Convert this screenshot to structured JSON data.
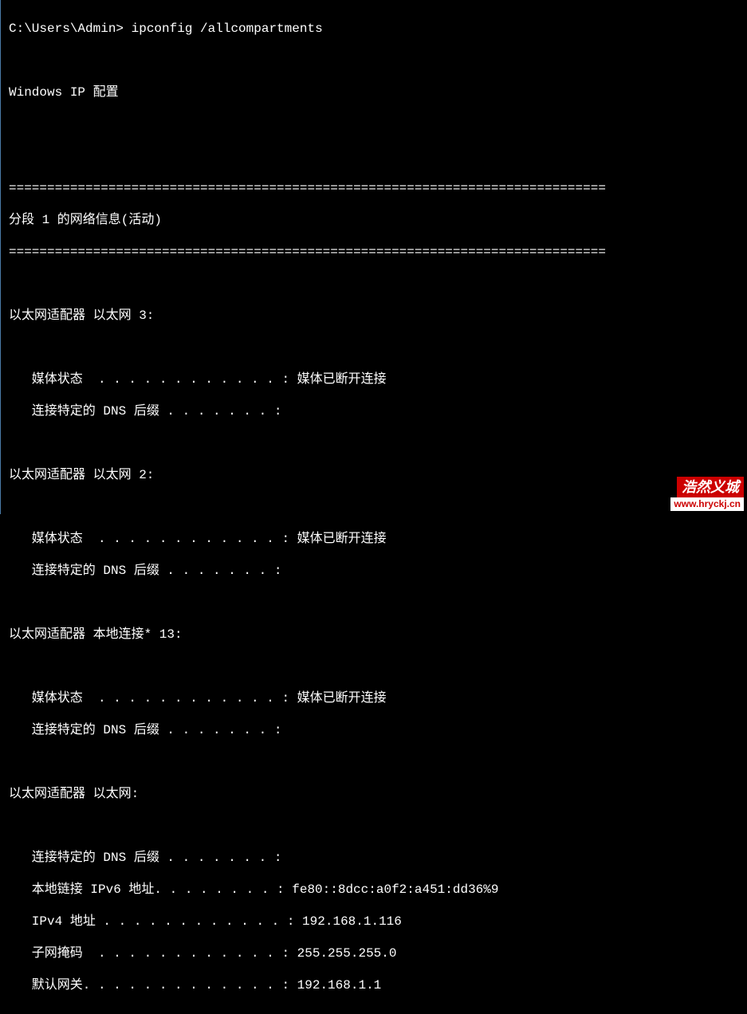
{
  "prompt": "C:\\Users\\Admin> ",
  "command": "ipconfig /allcompartments",
  "blank": "",
  "ip_config_header": "Windows IP 配置",
  "divider": "==============================================================================",
  "compartment_title": "分段 1 的网络信息(活动)",
  "adapters": [
    {
      "title": "以太网适配器 以太网 3:",
      "lines": [
        "   媒体状态  . . . . . . . . . . . . : 媒体已断开连接",
        "   连接特定的 DNS 后缀 . . . . . . . :"
      ]
    },
    {
      "title": "以太网适配器 以太网 2:",
      "lines": [
        "   媒体状态  . . . . . . . . . . . . : 媒体已断开连接",
        "   连接特定的 DNS 后缀 . . . . . . . :"
      ]
    },
    {
      "title": "以太网适配器 本地连接* 13:",
      "lines": [
        "   媒体状态  . . . . . . . . . . . . : 媒体已断开连接",
        "   连接特定的 DNS 后缀 . . . . . . . :"
      ]
    },
    {
      "title": "以太网适配器 以太网:",
      "lines": [
        "   连接特定的 DNS 后缀 . . . . . . . :",
        "   本地链接 IPv6 地址. . . . . . . . : fe80::8dcc:a0f2:a451:dd36%9",
        "   IPv4 地址 . . . . . . . . . . . . : 192.168.1.116",
        "   子网掩码  . . . . . . . . . . . . : 255.255.255.0",
        "   默认网关. . . . . . . . . . . . . : 192.168.1.1"
      ]
    }
  ],
  "watermark": {
    "top": "浩然义城",
    "bottom": "www.hryckj.cn"
  }
}
